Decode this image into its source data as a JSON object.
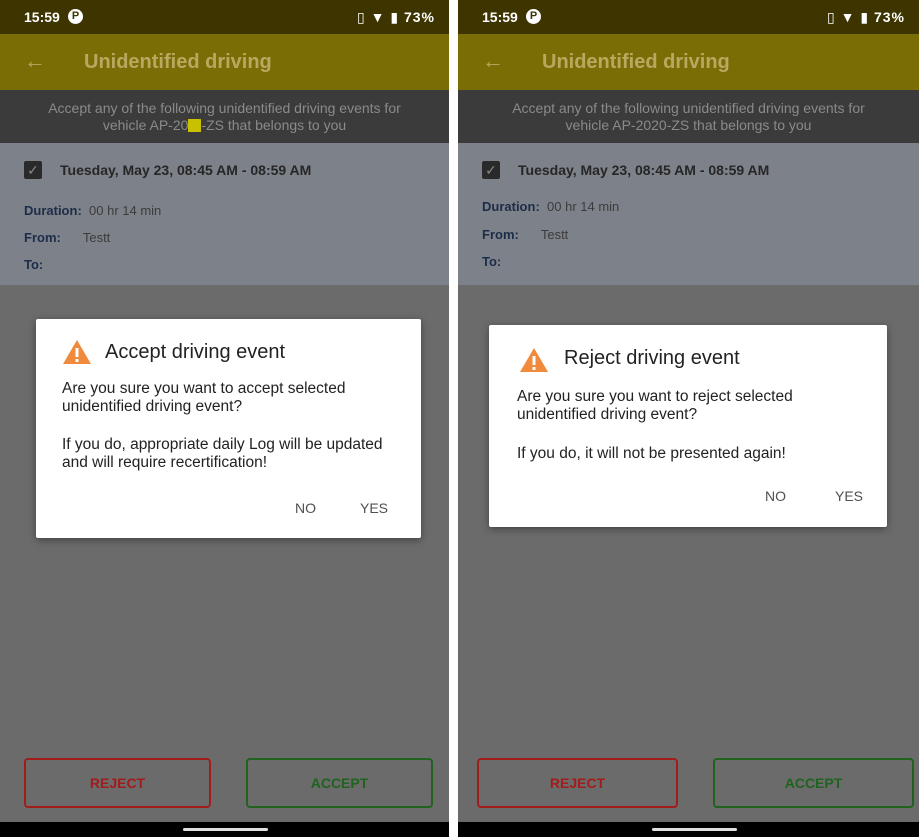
{
  "left": {
    "status_time": "15:59",
    "status_right": "73%",
    "app_title": "Unidentified driving",
    "banner_line1": "Accept any of the following unidentified driving events for",
    "banner_line2_before": "vehicle AP-20",
    "banner_line2_after": "-ZS that belongs to you",
    "event_date": "Tuesday, May 23, 08:45 AM - 08:59 AM",
    "duration_label": "Duration:",
    "duration_value": "00 hr  14 min",
    "from_label": "From:",
    "from_value": "Testt",
    "to_label": "To:",
    "dialog": {
      "title": "Accept driving event",
      "msg1": "Are you sure you want to accept selected unidentified driving event?",
      "msg2": "If you do, appropriate daily Log will be updated and will require recertification!",
      "no": "NO",
      "yes": "YES"
    },
    "reject_label": "REJECT",
    "accept_label": "ACCEPT"
  },
  "right": {
    "status_time": "15:59",
    "status_right": "73%",
    "app_title": "Unidentified driving",
    "banner_line1": "Accept any of the following unidentified driving events for",
    "banner_line2": "vehicle AP-2020-ZS that belongs to you",
    "event_date": "Tuesday, May 23, 08:45 AM - 08:59 AM",
    "duration_label": "Duration:",
    "duration_value": "00 hr  14 min",
    "from_label": "From:",
    "from_value": "Testt",
    "to_label": "To:",
    "dialog": {
      "title": "Reject driving event",
      "msg1": "Are you sure you want to reject selected unidentified driving event?",
      "msg2": "If you do, it will not be presented again!",
      "no": "NO",
      "yes": "YES"
    },
    "reject_label": "REJECT",
    "accept_label": "ACCEPT"
  },
  "colors": {
    "status_bar": "#3d3400",
    "app_bar": "#7a6d06",
    "warning": "#f08a3c",
    "reject": "#a21c1c",
    "accept": "#1f631f"
  },
  "icons": [
    "back-arrow-icon",
    "notification-icon",
    "vibrate-icon",
    "wifi-icon",
    "battery-icon",
    "checkbox-checked-icon",
    "warning-icon"
  ]
}
